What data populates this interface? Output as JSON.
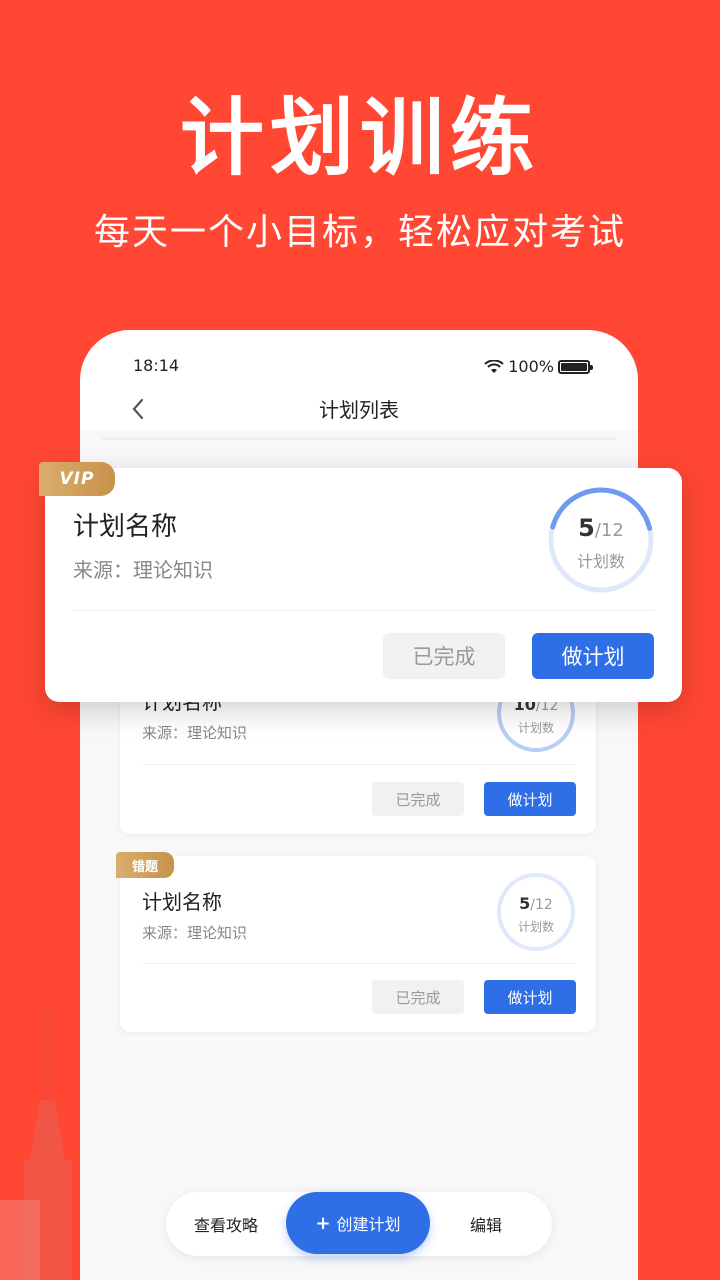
{
  "headline": "计划训练",
  "subline": "每天一个小目标，轻松应对考试",
  "colors": {
    "brand_red": "#ff4733",
    "primary_blue": "#2e6ee6",
    "tag_gold": "#c89149"
  },
  "status_bar": {
    "time": "18:14",
    "battery": "100%",
    "icons": [
      "wifi-icon",
      "battery-icon"
    ]
  },
  "navbar": {
    "title": "计划列表",
    "back_icon": "chevron-left-icon"
  },
  "float_card": {
    "tag": "VIP",
    "name": "计划名称",
    "source": "来源：理论知识",
    "progress_value": "5",
    "progress_total": "/12",
    "progress_fraction": 0.42,
    "progress_label": "计划数",
    "done_label": "已完成",
    "plan_label": "做计划"
  },
  "cards": [
    {
      "name": "计划名称",
      "source": "来源：理论知识",
      "progress_value": "10",
      "progress_total": "/12",
      "progress_label": "计划数",
      "done_label": "已完成",
      "plan_label": "做计划"
    },
    {
      "tag": "错题",
      "name": "计划名称",
      "source": "来源：理论知识",
      "progress_value": "5",
      "progress_total": "/12",
      "progress_label": "计划数",
      "done_label": "已完成",
      "plan_label": "做计划"
    }
  ],
  "bottom_bar": {
    "guide": "查看攻略",
    "create": "创建计划",
    "edit": "编辑"
  }
}
